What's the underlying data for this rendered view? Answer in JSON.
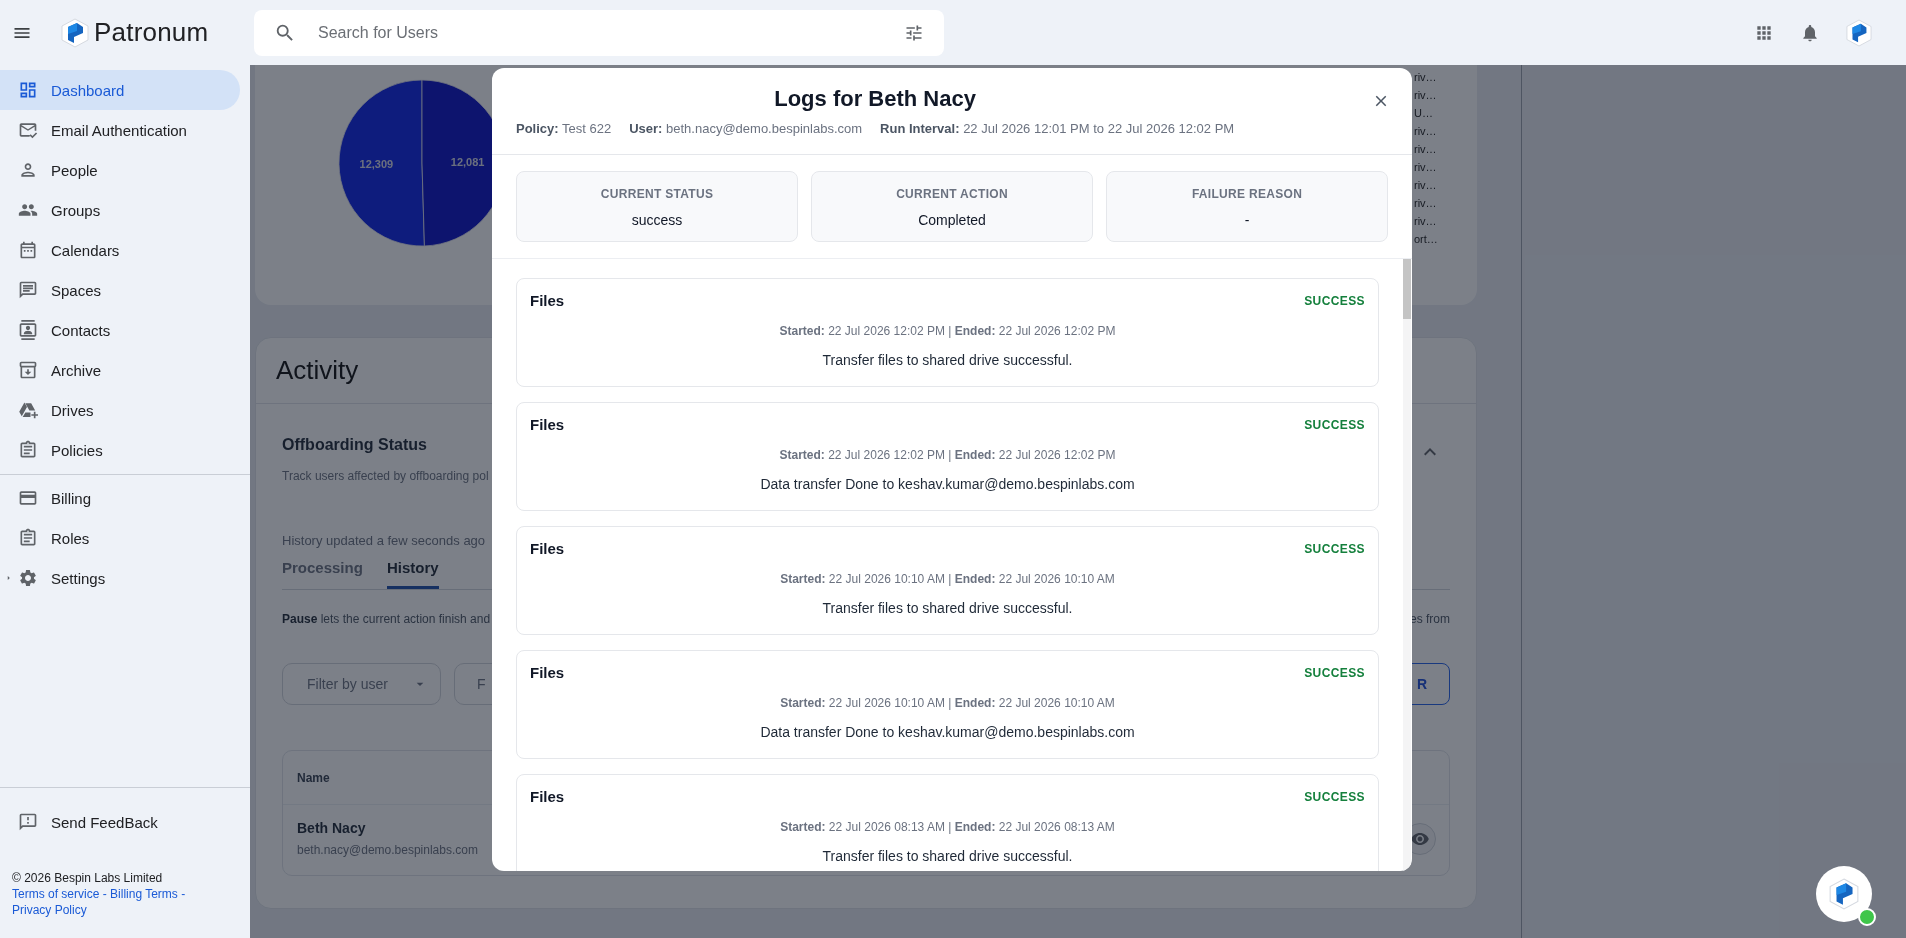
{
  "top_bar": {
    "brand": "Patronum",
    "search": {
      "placeholder": "Search for Users"
    }
  },
  "sidebar": {
    "items": [
      {
        "label": "Dashboard",
        "selected": true
      },
      {
        "label": "Email Authentication",
        "selected": false
      },
      {
        "label": "People",
        "selected": false
      },
      {
        "label": "Groups",
        "selected": false
      },
      {
        "label": "Calendars",
        "selected": false
      },
      {
        "label": "Spaces",
        "selected": false
      },
      {
        "label": "Contacts",
        "selected": false
      },
      {
        "label": "Archive",
        "selected": false
      },
      {
        "label": "Drives",
        "selected": false
      },
      {
        "label": "Policies",
        "selected": false
      }
    ],
    "secondary_items": [
      {
        "label": "Billing",
        "selected": false
      },
      {
        "label": "Roles",
        "selected": false
      },
      {
        "label": "Settings",
        "selected": false,
        "expanded": false
      }
    ],
    "feedback": "Send FeedBack",
    "copyright": "© 2026 Bespin Labs Limited",
    "links": [
      {
        "label": "Terms of service",
        "separator": "-"
      },
      {
        "label": "Billing Terms",
        "separator": "-"
      },
      {
        "label": "Privacy Policy"
      }
    ]
  },
  "dashboard": {
    "chart_card": {
      "chart_data": {
        "type": "pie",
        "values": [
          12309,
          12081
        ],
        "data_labels": true,
        "value_labels": [
          "12,309",
          "12,081"
        ]
      },
      "legend": [
        "riv…",
        "riv…",
        "U…",
        "riv…",
        "riv…",
        "riv…",
        "riv…",
        "riv…",
        "riv…",
        "ort…"
      ]
    },
    "activity": {
      "title": "Activity",
      "section_title": "Offboarding Status",
      "description": "Track users affected by offboarding pol",
      "updated": "History updated a few seconds ago",
      "tabs": [
        {
          "label": "Processing",
          "selected": false
        },
        {
          "label": "History",
          "selected": true
        }
      ],
      "note": "**Pause** lets the current action finish and",
      "note_tail": "es from",
      "filters": [
        "Filter by user",
        "F"
      ],
      "button_fragment": "R",
      "table": {
        "columns": [
          "Name"
        ],
        "rows": [
          {
            "name": "Beth Nacy",
            "email": "beth.nacy@demo.bespinlabs.com"
          }
        ]
      }
    }
  },
  "modal": {
    "title": "Logs for Beth Nacy",
    "meta": [
      "**Policy:** Test 622",
      "**User:** beth.nacy@demo.bespinlabs.com",
      "**Run Interval:** 22 Jul 2026 12:01 PM to 22 Jul 2026 12:02 PM"
    ],
    "status_cards": [
      {
        "label": "CURRENT STATUS",
        "value": "success"
      },
      {
        "label": "CURRENT ACTION",
        "value": "Completed"
      },
      {
        "label": "FAILURE REASON",
        "value": "-"
      }
    ],
    "logs": [
      {
        "title": "Files",
        "status": "SUCCESS",
        "times": "**Started:** 22 Jul 2026 12:02 PM | **Ended:** 22 Jul 2026 12:02 PM",
        "message": "Transfer files to shared drive successful."
      },
      {
        "title": "Files",
        "status": "SUCCESS",
        "times": "**Started:** 22 Jul 2026 12:02 PM | **Ended:** 22 Jul 2026 12:02 PM",
        "message": "Data transfer Done to keshav.kumar@demo.bespinlabs.com"
      },
      {
        "title": "Files",
        "status": "SUCCESS",
        "times": "**Started:** 22 Jul 2026 10:10 AM | **Ended:** 22 Jul 2026 10:10 AM",
        "message": "Transfer files to shared drive successful."
      },
      {
        "title": "Files",
        "status": "SUCCESS",
        "times": "**Started:** 22 Jul 2026 10:10 AM | **Ended:** 22 Jul 2026 10:10 AM",
        "message": "Data transfer Done to keshav.kumar@demo.bespinlabs.com"
      },
      {
        "title": "Files",
        "status": "SUCCESS",
        "times": "**Started:** 22 Jul 2026 08:13 AM | **Ended:** 22 Jul 2026 08:13 AM",
        "message": "Transfer files to shared drive successful."
      }
    ]
  }
}
